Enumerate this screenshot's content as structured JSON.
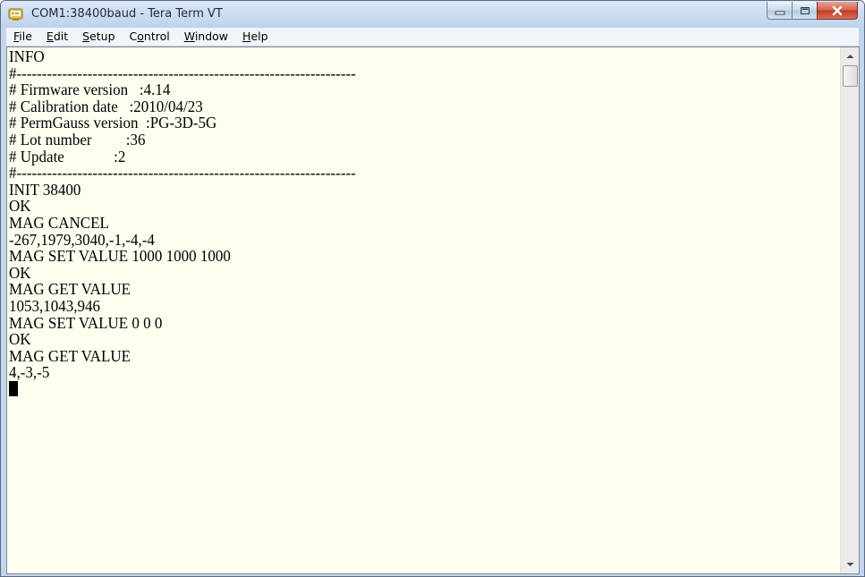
{
  "window": {
    "title": "COM1:38400baud - Tera Term VT",
    "app_icon": "tera-term-icon",
    "buttons": [
      "minimize-icon",
      "maximize-icon",
      "close-icon"
    ]
  },
  "menubar": {
    "items": [
      {
        "accel": "F",
        "rest": "ile"
      },
      {
        "accel": "E",
        "rest": "dit"
      },
      {
        "accel": "S",
        "rest": "etup"
      },
      {
        "pre": "C",
        "accel": "o",
        "rest": "ntrol"
      },
      {
        "accel": "W",
        "rest": "indow"
      },
      {
        "accel": "H",
        "rest": "elp"
      }
    ]
  },
  "terminal": {
    "lines": [
      "INFO",
      "#-------------------------------------------------------------------",
      "# Firmware version   :4.14",
      "# Calibration date   :2010/04/23",
      "# PermGauss version  :PG-3D-5G",
      "# Lot number         :36",
      "# Update             :2",
      "#-------------------------------------------------------------------",
      "INIT 38400",
      "OK",
      "MAG CANCEL",
      "-267,1979,3040,-1,-4,-4",
      "MAG SET VALUE 1000 1000 1000",
      "OK",
      "MAG GET VALUE",
      "1053,1043,946",
      "MAG SET VALUE 0 0 0",
      "OK",
      "MAG GET VALUE",
      "4,-3,-5"
    ]
  },
  "scrollbar": {
    "up_icon": "scroll-up-arrow-icon",
    "down_icon": "scroll-down-arrow-icon"
  }
}
